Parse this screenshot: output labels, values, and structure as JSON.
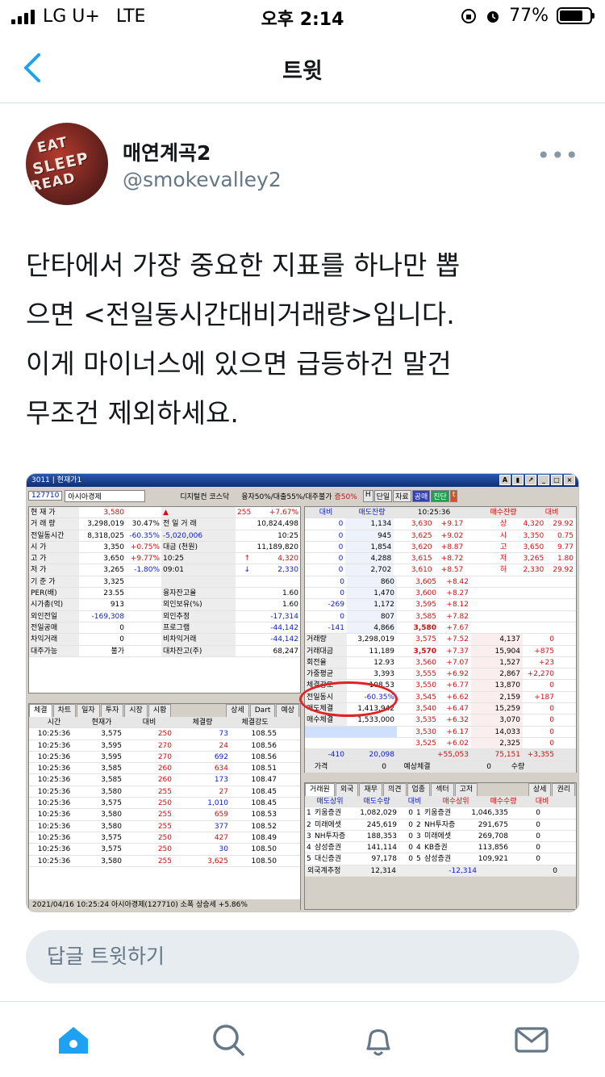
{
  "status": {
    "carrier": "LG U+",
    "network": "LTE",
    "time": "오후 2:14",
    "battery": "77%"
  },
  "nav": {
    "title": "트윗"
  },
  "author": {
    "name": "매연계곡2",
    "handle": "@smokevalley2",
    "avatar_text": [
      "EAT",
      "SLEEP",
      "READ"
    ]
  },
  "tweet": {
    "lines": [
      "단타에서 가장 중요한 지표를 하나만 뽑",
      "으면 <전일동시간대비거래량>입니다.",
      "이게 마이너스에 있으면 급등하건 말건",
      "무조건 제외하세요."
    ]
  },
  "screenshot": {
    "window_title": "3011 | 현재가1",
    "code": "127710",
    "stock_name": "아시아경제",
    "market_info": "디지털컨 코스닥",
    "margin_info": "융자50%/대출55%/대주불가",
    "margin_rate": "증50%",
    "right_buttons": [
      "H",
      "단일",
      "자료",
      "공매",
      "진단",
      "t"
    ],
    "summary": [
      [
        "현 재 가",
        "3,580",
        "",
        "▲",
        "255",
        "+7.67%"
      ],
      [
        "거 래 량",
        "3,298,019",
        "30.47%",
        "전 일 거 래",
        "",
        "10,824,498"
      ],
      [
        "전일동시간",
        "8,318,025",
        "-60.35%",
        "-5,020,006",
        "",
        "10:25"
      ],
      [
        "시 가",
        "3,350",
        "+0.75%",
        "대금 (천원)",
        "",
        "11,189,820"
      ],
      [
        "고 가",
        "3,650",
        "+9.77%",
        "10:25",
        "↑",
        "4,320"
      ],
      [
        "저 가",
        "3,265",
        "-1.80%",
        "09:01",
        "↓",
        "2,330"
      ],
      [
        "기 준 가",
        "3,325",
        "",
        "",
        "",
        ""
      ],
      [
        "PER(배)",
        "23.55",
        "",
        "융자잔고율",
        "",
        "1.60"
      ],
      [
        "시가총(억)",
        "913",
        "",
        "외인보유(%)",
        "",
        "1.60"
      ],
      [
        "외인전일",
        "-169,308",
        "",
        "외인추정",
        "",
        "-17,314"
      ],
      [
        "전일공매",
        "0",
        "",
        "프로그램",
        "",
        "-44,142"
      ],
      [
        "차익거래",
        "0",
        "",
        "비차익거래",
        "",
        "-44,142"
      ],
      [
        "대주가능",
        "불가",
        "",
        "대차잔고(주)",
        "",
        "68,247"
      ]
    ],
    "left_tabs": [
      "체결",
      "차트",
      "일자",
      "투자",
      "시장",
      "시황"
    ],
    "left_tab_buttons": [
      "상세",
      "Dart",
      "예상"
    ],
    "trade_headers": [
      "시간",
      "현재가",
      "대비",
      "체결량",
      "체결강도"
    ],
    "trades": [
      [
        "10:25:36",
        "3,575",
        "250",
        "73",
        "108.55"
      ],
      [
        "10:25:36",
        "3,595",
        "270",
        "24",
        "108.56"
      ],
      [
        "10:25:36",
        "3,595",
        "270",
        "692",
        "108.56"
      ],
      [
        "10:25:36",
        "3,585",
        "260",
        "634",
        "108.51"
      ],
      [
        "10:25:36",
        "3,585",
        "260",
        "173",
        "108.47"
      ],
      [
        "10:25:36",
        "3,580",
        "255",
        "27",
        "108.45"
      ],
      [
        "10:25:36",
        "3,575",
        "250",
        "1,010",
        "108.45"
      ],
      [
        "10:25:36",
        "3,580",
        "255",
        "659",
        "108.53"
      ],
      [
        "10:25:36",
        "3,580",
        "255",
        "377",
        "108.52"
      ],
      [
        "10:25:36",
        "3,575",
        "250",
        "427",
        "108.49"
      ],
      [
        "10:25:36",
        "3,575",
        "250",
        "30",
        "108.50"
      ],
      [
        "10:25:36",
        "3,580",
        "255",
        "3,625",
        "108.50"
      ]
    ],
    "left_footer": "2021/04/16 10:25:24  아시아경제(127710)  소폭 상승세 +5.86%",
    "ob_headers": [
      "대비",
      "매도잔량",
      "10:25:36",
      "매수잔량",
      "대비"
    ],
    "asks": [
      [
        "0",
        "1,134",
        "3,630",
        "+9.17"
      ],
      [
        "0",
        "945",
        "3,625",
        "+9.02"
      ],
      [
        "0",
        "1,854",
        "3,620",
        "+8.87"
      ],
      [
        "0",
        "4,288",
        "3,615",
        "+8.72"
      ],
      [
        "0",
        "2,702",
        "3,610",
        "+8.57"
      ],
      [
        "0",
        "860",
        "3,605",
        "+8.42"
      ],
      [
        "0",
        "1,470",
        "3,600",
        "+8.27"
      ],
      [
        "-269",
        "1,172",
        "3,595",
        "+8.12"
      ],
      [
        "0",
        "807",
        "3,585",
        "+7.82"
      ],
      [
        "-141",
        "4,866",
        "3,580",
        "+7.67"
      ]
    ],
    "side_info": [
      [
        "상",
        "4,320",
        "29.92"
      ],
      [
        "시",
        "3,350",
        "0.75"
      ],
      [
        "고",
        "3,650",
        "9.77"
      ],
      [
        "저",
        "3,265",
        "1.80"
      ],
      [
        "하",
        "2,330",
        "29.92"
      ]
    ],
    "mid_info": [
      [
        "거래량",
        "3,298,019"
      ],
      [
        "거래대금",
        "11,189"
      ],
      [
        "회전율",
        "12.93"
      ],
      [
        "가중평균",
        "3,393"
      ],
      [
        "체결강도",
        "108.53"
      ],
      [
        "전일동시",
        "-60.35%"
      ],
      [
        "매도체결",
        "1,413,942"
      ],
      [
        "매수체결",
        "1,533,000"
      ]
    ],
    "bids": [
      [
        "3,575",
        "+7.52",
        "4,137",
        "0"
      ],
      [
        "3,570",
        "+7.37",
        "15,904",
        "+875"
      ],
      [
        "3,560",
        "+7.07",
        "1,527",
        "+23"
      ],
      [
        "3,555",
        "+6.92",
        "2,867",
        "+2,270"
      ],
      [
        "3,550",
        "+6.77",
        "13,870",
        "0"
      ],
      [
        "3,545",
        "+6.62",
        "2,159",
        "+187"
      ],
      [
        "3,540",
        "+6.47",
        "15,259",
        "0"
      ],
      [
        "3,535",
        "+6.32",
        "3,070",
        "0"
      ],
      [
        "3,530",
        "+6.17",
        "14,033",
        "0"
      ],
      [
        "3,525",
        "+6.02",
        "2,325",
        "0"
      ]
    ],
    "ob_total": [
      "-410",
      "20,098",
      "+55,053",
      "75,151",
      "+3,355"
    ],
    "expected": [
      "가격",
      "0",
      "예상체결",
      "0",
      "수량"
    ],
    "broker_tabs": [
      "거래원",
      "외국",
      "재무",
      "의견",
      "업종",
      "섹터",
      "고저"
    ],
    "broker_buttons": [
      "상세",
      "권리"
    ],
    "broker_headers": [
      "매도상위",
      "매도수량",
      "대비",
      "매수상위",
      "매수수량",
      "대비"
    ],
    "brokers": [
      [
        "1",
        "키움증권",
        "1,082,029",
        "0",
        "1",
        "키움증권",
        "1,046,335",
        "0"
      ],
      [
        "2",
        "미래에셋",
        "245,619",
        "0",
        "2",
        "NH투자증",
        "291,675",
        "0"
      ],
      [
        "3",
        "NH투자증",
        "188,353",
        "0",
        "3",
        "미래에셋",
        "269,708",
        "0"
      ],
      [
        "4",
        "삼성증권",
        "141,114",
        "0",
        "4",
        "KB증권",
        "113,856",
        "0"
      ],
      [
        "5",
        "대신증권",
        "97,178",
        "0",
        "5",
        "삼성증권",
        "109,921",
        "0"
      ]
    ],
    "foreign_estimate": [
      "외국계추정",
      "12,314",
      "-12,314",
      "0"
    ]
  },
  "reply": {
    "placeholder": "답글 트윗하기"
  },
  "tabbar": [
    "home-icon",
    "search-icon",
    "notifications-icon",
    "messages-icon"
  ]
}
